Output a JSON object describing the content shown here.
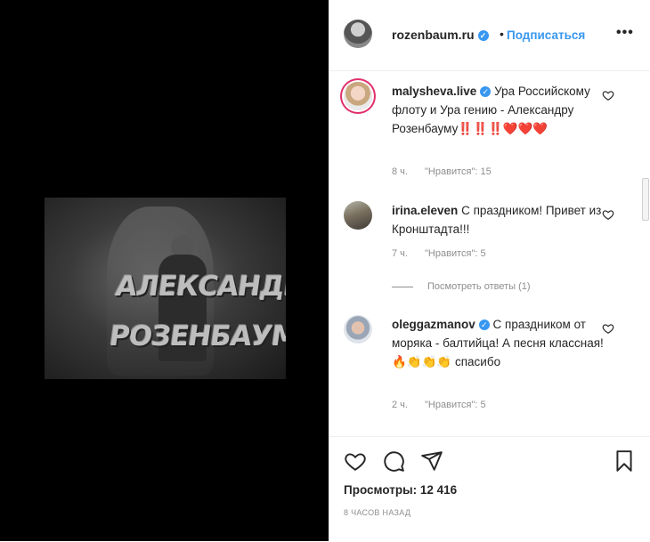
{
  "media": {
    "overlay_line1": "АЛЕКСАНДР",
    "overlay_line2": "РОЗЕНБАУМ"
  },
  "header": {
    "username": "rozenbaum.ru",
    "separator": "•",
    "follow_label": "Подписаться",
    "more_label": "•••"
  },
  "comments": [
    {
      "username": "malysheva.live",
      "verified": true,
      "text": "Ура Российскому флоту и Ура гению - Александру Розенбауму‼️‼️‼️❤️❤️❤️",
      "time": "8 ч.",
      "likes": "\"Нравится\": 15"
    },
    {
      "username": "irina.eleven",
      "verified": false,
      "text": "С праздником! Привет из Кронштадта!!!",
      "time": "7 ч.",
      "likes": "\"Нравится\": 5",
      "replies_label": "Посмотреть ответы (1)"
    },
    {
      "username": "oleggazmanov",
      "verified": true,
      "text": "С праздником от моряка - балтийца! А песня классная!🔥👏👏👏 спасибо",
      "time": "2 ч.",
      "likes": "\"Нравится\": 5"
    }
  ],
  "footer": {
    "views": "Просмотры: 12 416",
    "time_ago": "8 ЧАСОВ НАЗАД"
  },
  "colors": {
    "accent": "#3897f0",
    "heart": "#e0245e",
    "muted": "#8e8e8e"
  },
  "icons": [
    "heart-icon",
    "comment-icon",
    "share-icon",
    "bookmark-icon",
    "more-icon",
    "verified-icon"
  ]
}
